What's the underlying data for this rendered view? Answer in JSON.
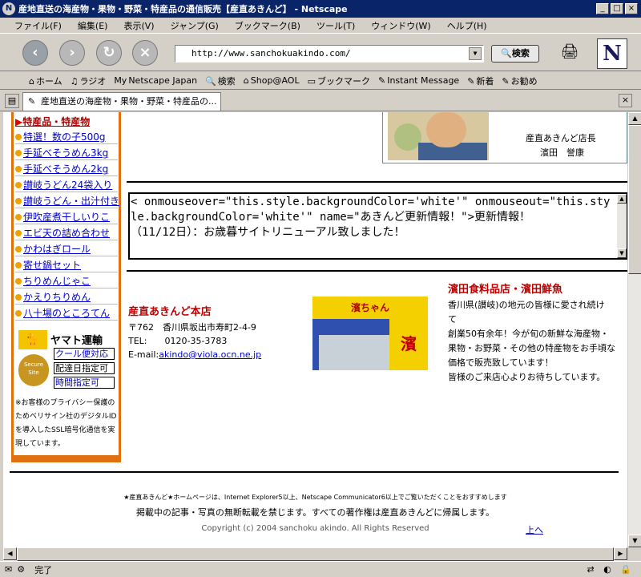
{
  "window": {
    "title": "産地直送の海産物・果物・野菜・特産品の通信販売【産直あきんど】 - Netscape",
    "app_icon": "N"
  },
  "menu": [
    "ファイル(F)",
    "編集(E)",
    "表示(V)",
    "ジャンプ(G)",
    "ブックマーク(B)",
    "ツール(T)",
    "ウィンドウ(W)",
    "ヘルプ(H)"
  ],
  "nav": {
    "url": "http://www.sanchokuakindo.com/",
    "search_label": "検索",
    "logo": "N"
  },
  "personal_toolbar": [
    "ホーム",
    "ラジオ",
    "Netscape Japan",
    "検索",
    "Shop@AOL",
    "ブックマーク",
    "Instant Message",
    "新着",
    "お勧め"
  ],
  "tab": {
    "label": "産地直送の海産物・果物・野菜・特産品の..."
  },
  "sidebar": {
    "heading": "特産品・特産物",
    "links": [
      "特選！数の子500g",
      "手延べそうめん3kg",
      "手延べそうめん2kg",
      "讃岐うどん24袋入り",
      "讃岐うどん・出汁付き",
      "伊吹産煮干しいりこ",
      "エビ天の詰め合わせ",
      "かわはぎロール",
      "寄せ鍋セット",
      "ちりめんじゃこ",
      "かえりちりめん",
      "八十場のところてん"
    ],
    "yamato_name": "ヤマト運輸",
    "yamato_tags": [
      "クール便対応",
      "配達日指定可",
      "時間指定可"
    ],
    "badge_text": "Secure Site",
    "privacy_note": "※お客様のプライバシー保護のためベリサイン社のデジタルIDを導入したSSL暗号化通信を実現しています。"
  },
  "manager": {
    "title": "産直あきんど店長",
    "name": "濱田　誉康"
  },
  "news": {
    "text": "< onmouseover=\"this.style.backgroundColor='white'\" onmouseout=\"this.style.backgroundColor='white'\" name=\"あきんど更新情報！\">更新情報！\n（11/12日）：お歳暮サイトリニューアル致しました！"
  },
  "store": {
    "name": "産直あきんど本店",
    "postal": "〒762　香川県坂出市寿町2-4-9",
    "tel": "TEL:　　0120-35-3783",
    "email_label": "E-mail:",
    "email": "akindo@viola.ocn.ne.jp",
    "sign_text": "濱ちゃん"
  },
  "shop": {
    "title": "濱田食料品店・濱田鮮魚",
    "lines": [
      "香川県(讃岐)の地元の皆様に愛され続け",
      "て",
      "創業50有余年！今が旬の新鮮な海産物・",
      "果物・お野菜・その他の特産物をお手頃な",
      "価格で販売致しています！",
      "皆様のご来店心よりお待ちしています。"
    ]
  },
  "footer": {
    "note": "★産直あきんど★ホームページは、Internet Explorer5以上、Netscape Communicator6以上でご覧いただくことをおすすめします",
    "rights": "掲載中の記事・写真の無断転載を禁じます。すべての著作権は産直あきんどに帰属します。",
    "copyright": "Copyright (c) 2004 sanchoku akindo. All Rights Reserved",
    "top_link": "上へ"
  },
  "status": {
    "text": "完了"
  }
}
